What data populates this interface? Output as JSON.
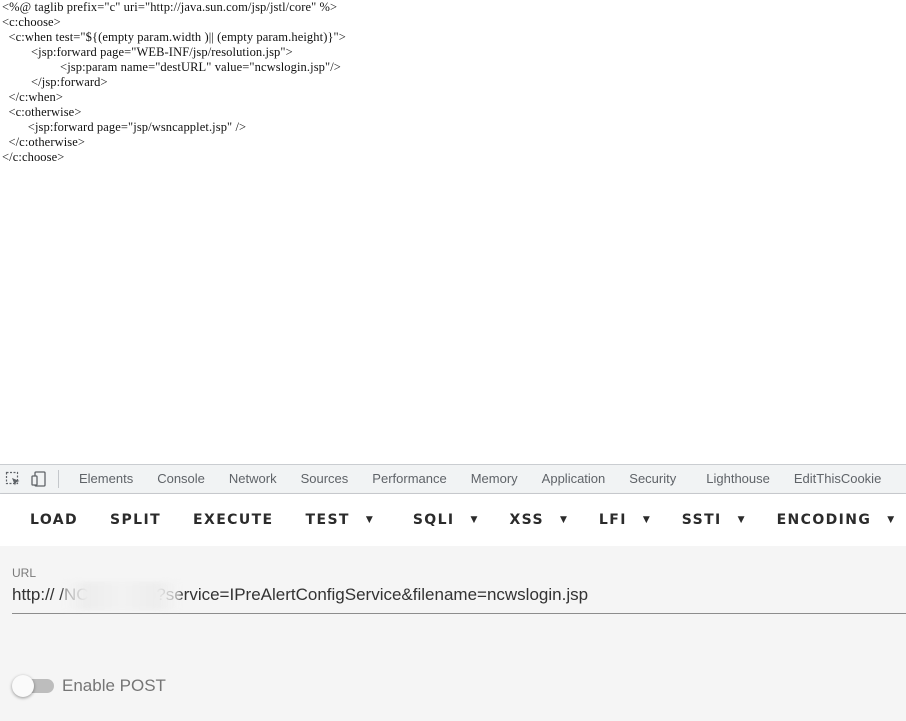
{
  "source": {
    "lines": [
      "<%@ taglib prefix=\"c\" uri=\"http://java.sun.com/jsp/jstl/core\" %>",
      "<c:choose>",
      "  <c:when test=\"${(empty param.width )|| (empty param.height)}\">",
      "         <jsp:forward page=\"WEB-INF/jsp/resolution.jsp\">",
      "                  <jsp:param name=\"destURL\" value=\"ncwslogin.jsp\"/>",
      "         </jsp:forward>",
      "  </c:when>",
      "  <c:otherwise>",
      "        <jsp:forward page=\"jsp/wsncapplet.jsp\" />",
      "  </c:otherwise>",
      "</c:choose>"
    ]
  },
  "devtools": {
    "tabs": [
      "Elements",
      "Console",
      "Network",
      "Sources",
      "Performance",
      "Memory",
      "Application",
      "Security",
      "Lighthouse",
      "EditThisCookie"
    ],
    "icons": [
      "inspect-element-icon",
      "device-toolbar-icon"
    ]
  },
  "hackbar": {
    "buttons": {
      "load": "LOAD",
      "split": "SPLIT",
      "execute": "EXECUTE",
      "test": "TEST",
      "sqli": "SQLI",
      "xss": "XSS",
      "lfi": "LFI",
      "ssti": "SSTI",
      "encoding": "ENCODING"
    },
    "dropdown_caret": "▼",
    "url_label": "URL",
    "url_value": "http://                          /NCFindWeb?service=IPreAlertConfigService&filename=ncwslogin.jsp",
    "enable_post_label": "Enable POST",
    "enable_post": false
  }
}
